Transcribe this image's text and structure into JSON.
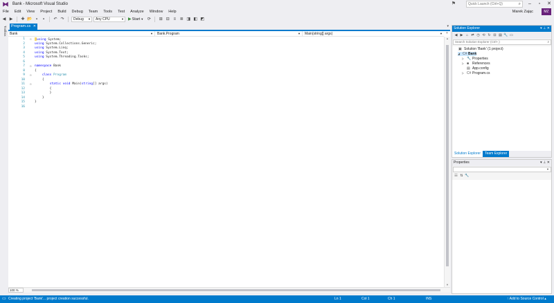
{
  "window": {
    "title": "Bank - Microsoft Visual Studio",
    "quick_launch_placeholder": "Quick Launch (Ctrl+Q)",
    "user": "Marek Zając",
    "avatar_initials": "MZ"
  },
  "menu": [
    "File",
    "Edit",
    "View",
    "Project",
    "Build",
    "Debug",
    "Team",
    "Tools",
    "Test",
    "Analyze",
    "Window",
    "Help"
  ],
  "toolbar": {
    "config": "Debug",
    "platform": "Any CPU",
    "start_label": "Start"
  },
  "left_strip": {
    "toolbox_label": "Toolbox"
  },
  "editor": {
    "tab_label": "Program.cs",
    "nav_project": "Bank",
    "nav_class": "Bank.Program",
    "nav_member": "Main(string[] args)",
    "zoom": "100 %",
    "lines": [
      {
        "n": "1",
        "fold": "⊟",
        "code": "using System;",
        "style": "using"
      },
      {
        "n": "2",
        "fold": "",
        "code": "using System.Collections.Generic;",
        "style": "using"
      },
      {
        "n": "3",
        "fold": "",
        "code": "using System.Linq;",
        "style": "using"
      },
      {
        "n": "4",
        "fold": "",
        "code": "using System.Text;",
        "style": "using"
      },
      {
        "n": "5",
        "fold": "",
        "code": "using System.Threading.Tasks;",
        "style": "using"
      },
      {
        "n": "6",
        "fold": "",
        "code": "",
        "style": "plain"
      },
      {
        "n": "7",
        "fold": "⊟",
        "code": "namespace Bank",
        "style": "namespace"
      },
      {
        "n": "8",
        "fold": "",
        "code": "{",
        "style": "plain"
      },
      {
        "n": "9",
        "fold": "⊟",
        "code": "    class Program",
        "style": "class"
      },
      {
        "n": "10",
        "fold": "",
        "code": "    {",
        "style": "plain"
      },
      {
        "n": "11",
        "fold": "⊟",
        "code": "        static void Main(string[] args)",
        "style": "method"
      },
      {
        "n": "12",
        "fold": "",
        "code": "        {",
        "style": "plain"
      },
      {
        "n": "13",
        "fold": "",
        "code": "        }",
        "style": "plain"
      },
      {
        "n": "14",
        "fold": "",
        "code": "    }",
        "style": "plain"
      },
      {
        "n": "15",
        "fold": "",
        "code": "}",
        "style": "plain"
      },
      {
        "n": "16",
        "fold": "",
        "code": "",
        "style": "plain"
      }
    ]
  },
  "solution_explorer": {
    "title": "Solution Explorer",
    "search_placeholder": "Search Solution Explorer (Ctrl+;)",
    "tree": [
      {
        "label": "Solution 'Bank' (1 project)",
        "depth": 0,
        "exp": "",
        "icon": "solution-icon",
        "glyph": "▣"
      },
      {
        "label": "Bank",
        "depth": 1,
        "exp": "◢",
        "icon": "csharp-project-icon",
        "glyph": "C#",
        "bold": true
      },
      {
        "label": "Properties",
        "depth": 2,
        "exp": "▷",
        "icon": "wrench-icon",
        "glyph": "🔧"
      },
      {
        "label": "References",
        "depth": 2,
        "exp": "▷",
        "icon": "references-icon",
        "glyph": "■"
      },
      {
        "label": "App.config",
        "depth": 2,
        "exp": "",
        "icon": "config-file-icon",
        "glyph": "▤"
      },
      {
        "label": "Program.cs",
        "depth": 2,
        "exp": "▷",
        "icon": "csharp-file-icon",
        "glyph": "C#"
      }
    ],
    "tabs": [
      "Solution Explorer",
      "Team Explorer"
    ]
  },
  "properties": {
    "title": "Properties"
  },
  "status": {
    "message": "Creating project 'Bank'... project creation successful.",
    "ln": "Ln 1",
    "col": "Col 1",
    "ch": "Ch 1",
    "ins": "INS",
    "add_sc": "↑ Add to Source Control ▴"
  }
}
